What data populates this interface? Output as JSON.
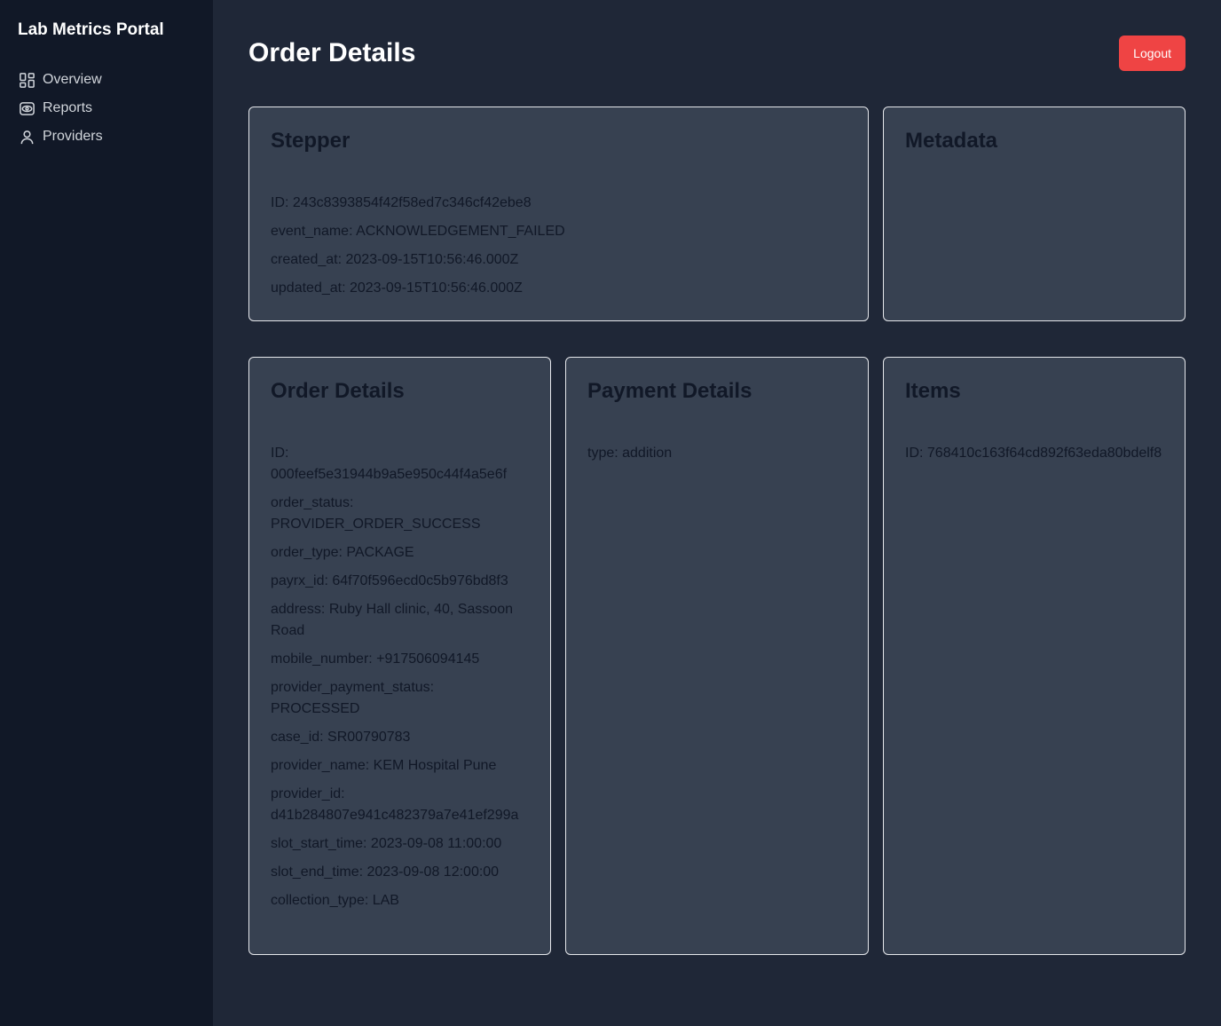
{
  "app": {
    "title": "Lab Metrics Portal"
  },
  "sidebar": {
    "items": [
      {
        "label": "Overview",
        "icon": "grid-icon"
      },
      {
        "label": "Reports",
        "icon": "eye-icon"
      },
      {
        "label": "Providers",
        "icon": "user-icon"
      }
    ]
  },
  "header": {
    "title": "Order Details",
    "logout_label": "Logout"
  },
  "stepper": {
    "title": "Stepper",
    "fields": [
      "ID: 243c8393854f42f58ed7c346cf42ebe8",
      "event_name: ACKNOWLEDGEMENT_FAILED",
      "created_at: 2023-09-15T10:56:46.000Z",
      "updated_at: 2023-09-15T10:56:46.000Z"
    ]
  },
  "metadata": {
    "title": "Metadata"
  },
  "order_details": {
    "title": "Order Details",
    "fields": [
      "ID: 000feef5e31944b9a5e950c44f4a5e6f",
      "order_status: PROVIDER_ORDER_SUCCESS",
      "order_type: PACKAGE",
      "payrx_id: 64f70f596ecd0c5b976bd8f3",
      "address: Ruby Hall clinic, 40, Sassoon Road",
      "mobile_number: +917506094145",
      "provider_payment_status: PROCESSED",
      "case_id: SR00790783",
      "provider_name: KEM Hospital Pune",
      "provider_id: d41b284807e941c482379a7e41ef299a",
      "slot_start_time: 2023-09-08 11:00:00",
      "slot_end_time: 2023-09-08 12:00:00",
      "collection_type: LAB"
    ]
  },
  "payment_details": {
    "title": "Payment Details",
    "fields": [
      "type: addition"
    ]
  },
  "items": {
    "title": "Items",
    "fields": [
      "ID: 768410c163f64cd892f63eda80bdelf8"
    ]
  }
}
